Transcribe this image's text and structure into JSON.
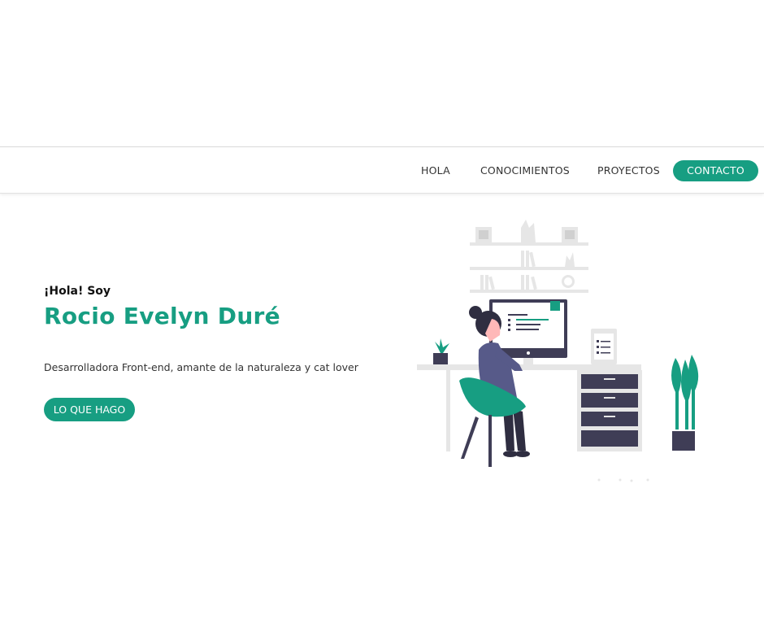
{
  "nav": {
    "items": [
      {
        "label": "HOLA"
      },
      {
        "label": "CONOCIMIENTOS"
      },
      {
        "label": "PROYECTOS"
      }
    ],
    "cta_label": "CONTACTO"
  },
  "hero": {
    "greeting": "¡Hola! Soy",
    "name": "Rocio Evelyn Duré",
    "tagline": "Desarrolladora Front-end, amante de la naturaleza y cat lover",
    "button_label": "LO QUE HAGO"
  },
  "theme": {
    "accent": "#179e82",
    "dark": "#3f3d56",
    "light_gray": "#e6e6e6"
  },
  "illustration": {
    "icon": "woman-at-desk-illustration"
  }
}
